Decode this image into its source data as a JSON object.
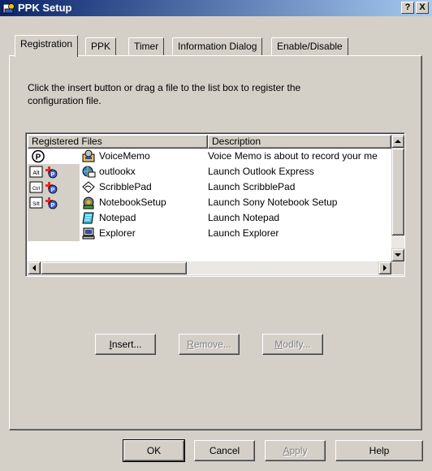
{
  "window": {
    "title": "PPK Setup",
    "help_button": "?",
    "close_button": "X"
  },
  "tabs": [
    {
      "label": "Registration",
      "active": true
    },
    {
      "label": "PPK",
      "active": false
    },
    {
      "label": "Timer",
      "active": false
    },
    {
      "label": "Information Dialog",
      "active": false
    },
    {
      "label": "Enable/Disable",
      "active": false
    }
  ],
  "registration": {
    "instructions": "Click the insert button or drag a file to the list box to register the configuration file.",
    "list": {
      "columns": [
        "Registered Files",
        "Description"
      ],
      "rows": [
        {
          "key_icon": "p-circle-icon",
          "app_icon": "voicememo-icon",
          "name": "VoiceMemo",
          "description": "Voice Memo is about to record your me"
        },
        {
          "key_icon": "alt-plus-p-icon",
          "app_icon": "outlook-express-icon",
          "name": "outlookx",
          "description": "Launch Outlook Express"
        },
        {
          "key_icon": "ctrl-plus-p-icon",
          "app_icon": "scribblepad-icon",
          "name": "ScribblePad",
          "description": "Launch ScribblePad"
        },
        {
          "key_icon": "shift-plus-p-icon",
          "app_icon": "notebook-setup-icon",
          "name": "NotebookSetup",
          "description": "Launch Sony Notebook Setup"
        },
        {
          "key_icon": "",
          "app_icon": "notepad-icon",
          "name": "Notepad",
          "description": "Launch Notepad"
        },
        {
          "key_icon": "",
          "app_icon": "explorer-icon",
          "name": "Explorer",
          "description": "Launch Explorer"
        }
      ]
    },
    "buttons": {
      "insert": "Insert...",
      "remove": "Remove...",
      "modify": "Modify..."
    }
  },
  "footer": {
    "ok": "OK",
    "cancel": "Cancel",
    "apply": "Apply",
    "help": "Help"
  },
  "colors": {
    "face": "#d4d0c8",
    "title_start": "#0a246a",
    "title_end": "#a6caf0",
    "disabled_text": "#808080"
  }
}
